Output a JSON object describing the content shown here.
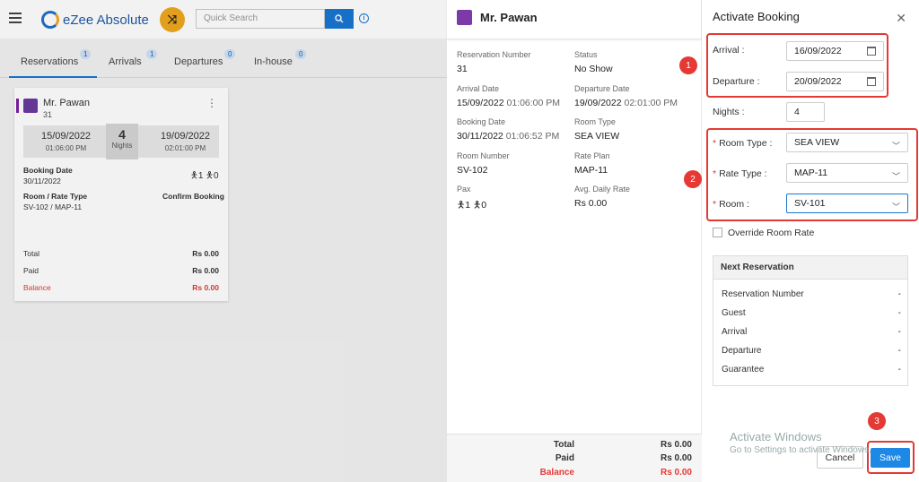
{
  "app": {
    "logo_text": "eZee Absolute",
    "search_placeholder": "Quick Search"
  },
  "tabs": [
    {
      "label": "Reservations",
      "badge": "1"
    },
    {
      "label": "Arrivals",
      "badge": "1"
    },
    {
      "label": "Departures",
      "badge": "0"
    },
    {
      "label": "In-house",
      "badge": "0"
    }
  ],
  "card": {
    "name": "Mr. Pawan",
    "number": "31",
    "arrival_date": "15/09/2022",
    "arrival_time": "01:06:00 PM",
    "nights": "4",
    "nights_label": "Nights",
    "departure_date": "19/09/2022",
    "departure_time": "02:01:00 PM",
    "booking_date_label": "Booking Date",
    "booking_date": "30/11/2022",
    "pax_adult": "1",
    "pax_child": "0",
    "room_rate_label": "Room / Rate Type",
    "room_rate": "SV-102 / MAP-11",
    "status": "Confirm Booking",
    "total_label": "Total",
    "total": "Rs 0.00",
    "paid_label": "Paid",
    "paid": "Rs 0.00",
    "balance_label": "Balance",
    "balance": "Rs 0.00",
    "menu_icon": "⋮"
  },
  "detail": {
    "name": "Mr. Pawan",
    "reservation_number_label": "Reservation Number",
    "reservation_number": "31",
    "status_label": "Status",
    "status": "No Show",
    "arrival_label": "Arrival Date",
    "arrival_date": "15/09/2022",
    "arrival_time": "01:06:00 PM",
    "departure_label": "Departure Date",
    "departure_date": "19/09/2022",
    "departure_time": "02:01:00 PM",
    "booking_label": "Booking Date",
    "booking_date": "30/11/2022",
    "booking_time": "01:06:52 PM",
    "room_type_label": "Room Type",
    "room_type": "SEA VIEW",
    "room_number_label": "Room Number",
    "room_number": "SV-102",
    "rate_plan_label": "Rate Plan",
    "rate_plan": "MAP-11",
    "pax_label": "Pax",
    "pax_adult": "1",
    "pax_child": "0",
    "adr_label": "Avg. Daily Rate",
    "adr": "Rs 0.00",
    "total_label": "Total",
    "total": "Rs 0.00",
    "paid_label": "Paid",
    "paid": "Rs 0.00",
    "balance_label": "Balance",
    "balance": "Rs 0.00"
  },
  "activate": {
    "title": "Activate Booking",
    "close": "✕",
    "arrival_label": "Arrival :",
    "arrival": "16/09/2022",
    "departure_label": "Departure :",
    "departure": "20/09/2022",
    "nights_label": "Nights :",
    "nights": "4",
    "room_type_label": "Room Type :",
    "room_type": "SEA VIEW",
    "rate_type_label": "Rate Type :",
    "rate_type": "MAP-11",
    "room_label": "Room :",
    "room": "SV-101",
    "override_label": "Override Room Rate",
    "next_title": "Next Reservation",
    "next_rows": [
      {
        "label": "Reservation Number",
        "value": "-"
      },
      {
        "label": "Guest",
        "value": "-"
      },
      {
        "label": "Arrival",
        "value": "-"
      },
      {
        "label": "Departure",
        "value": "-"
      },
      {
        "label": "Guarantee",
        "value": "-"
      }
    ],
    "cancel": "Cancel",
    "save": "Save"
  },
  "markers": [
    "1",
    "2",
    "3"
  ],
  "watermark": {
    "line1": "Activate Windows",
    "line2": "Go to Settings to activate Windows."
  },
  "colors": {
    "accent": "#1976d2",
    "annotation": "#e53935",
    "balance": "#e53935"
  }
}
